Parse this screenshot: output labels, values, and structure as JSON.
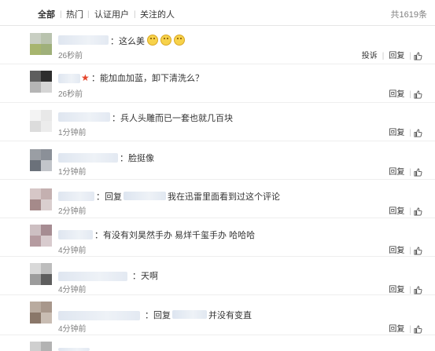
{
  "tabs": [
    {
      "label": "全部",
      "active": true
    },
    {
      "label": "热门",
      "active": false
    },
    {
      "label": "认证用户",
      "active": false
    },
    {
      "label": "关注的人",
      "active": false
    }
  ],
  "total": "共1619条",
  "actions": {
    "report": "投诉",
    "reply": "回复"
  },
  "comments": [
    {
      "text": "：这么美",
      "time": "26秒前"
    },
    {
      "text": "：能加血加蓝，卸下清洗么？",
      "time": "26秒前"
    },
    {
      "text": "：兵人头雕而已一套也就几百块",
      "time": "1分钟前"
    },
    {
      "text": "：脸挺像",
      "time": "1分钟前"
    },
    {
      "text_a": "：回复",
      "text_b": "我在迅雷里面看到过这个评论",
      "time": "2分钟前"
    },
    {
      "text": "：有没有刘昊然手办 易烊千玺手办 哈哈哈",
      "time": "4分钟前"
    },
    {
      "text": "：天啊",
      "time": "4分钟前"
    },
    {
      "text_a": "：回复",
      "text_b": "并没有变直",
      "time": "4分钟前"
    }
  ],
  "icons": {
    "like": "thumbs-up-icon",
    "emoji": "smile-emoji-icon",
    "vip": "star-icon"
  }
}
